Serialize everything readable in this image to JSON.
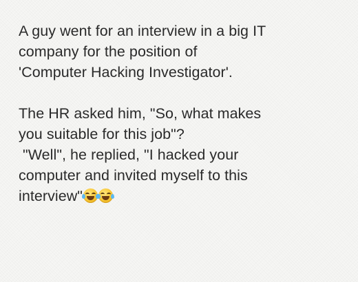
{
  "note": {
    "paragraph1": [
      "A guy went for an interview in a big IT",
      "company for the position of",
      "'Computer Hacking Investigator'."
    ],
    "paragraph2": [
      "The HR asked him, \"So, what makes",
      "you suitable for this job\"?",
      " \"Well\", he replied, \"I hacked your",
      "computer and invited myself to this",
      "interview\""
    ],
    "trailing_icons": [
      "tears-of-joy-icon",
      "tears-of-joy-icon"
    ]
  },
  "colors": {
    "background": "#f6f6f4",
    "text": "#2a2a2a"
  }
}
